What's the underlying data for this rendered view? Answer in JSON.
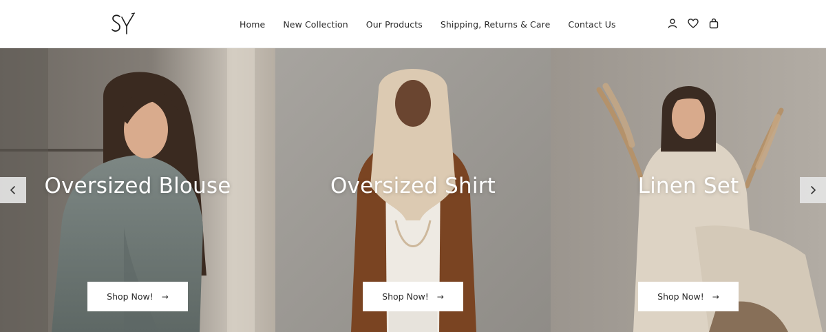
{
  "brand": {
    "logo_text": "SY"
  },
  "nav": {
    "items": [
      {
        "label": "Home"
      },
      {
        "label": "New Collection"
      },
      {
        "label": "Our Products"
      },
      {
        "label": "Shipping, Returns & Care"
      },
      {
        "label": "Contact Us"
      }
    ],
    "icons": [
      "user-icon",
      "heart-icon",
      "shopping-bag-icon"
    ]
  },
  "hero": {
    "panels": [
      {
        "title": "Oversized Blouse",
        "button_label": "Shop Now!",
        "button_arrow": "→"
      },
      {
        "title": "Oversized Shirt",
        "button_label": "Shop Now!",
        "button_arrow": "→"
      },
      {
        "title": "Linen Set",
        "button_label": "Shop Now!",
        "button_arrow": "→"
      }
    ],
    "prev_icon": "chevron-left-icon",
    "next_icon": "chevron-right-icon"
  },
  "colors": {
    "header_bg": "#ffffff",
    "text": "#2a2a2a",
    "button_bg": "#ffffff",
    "arrow_bg": "#e4e4e4"
  }
}
